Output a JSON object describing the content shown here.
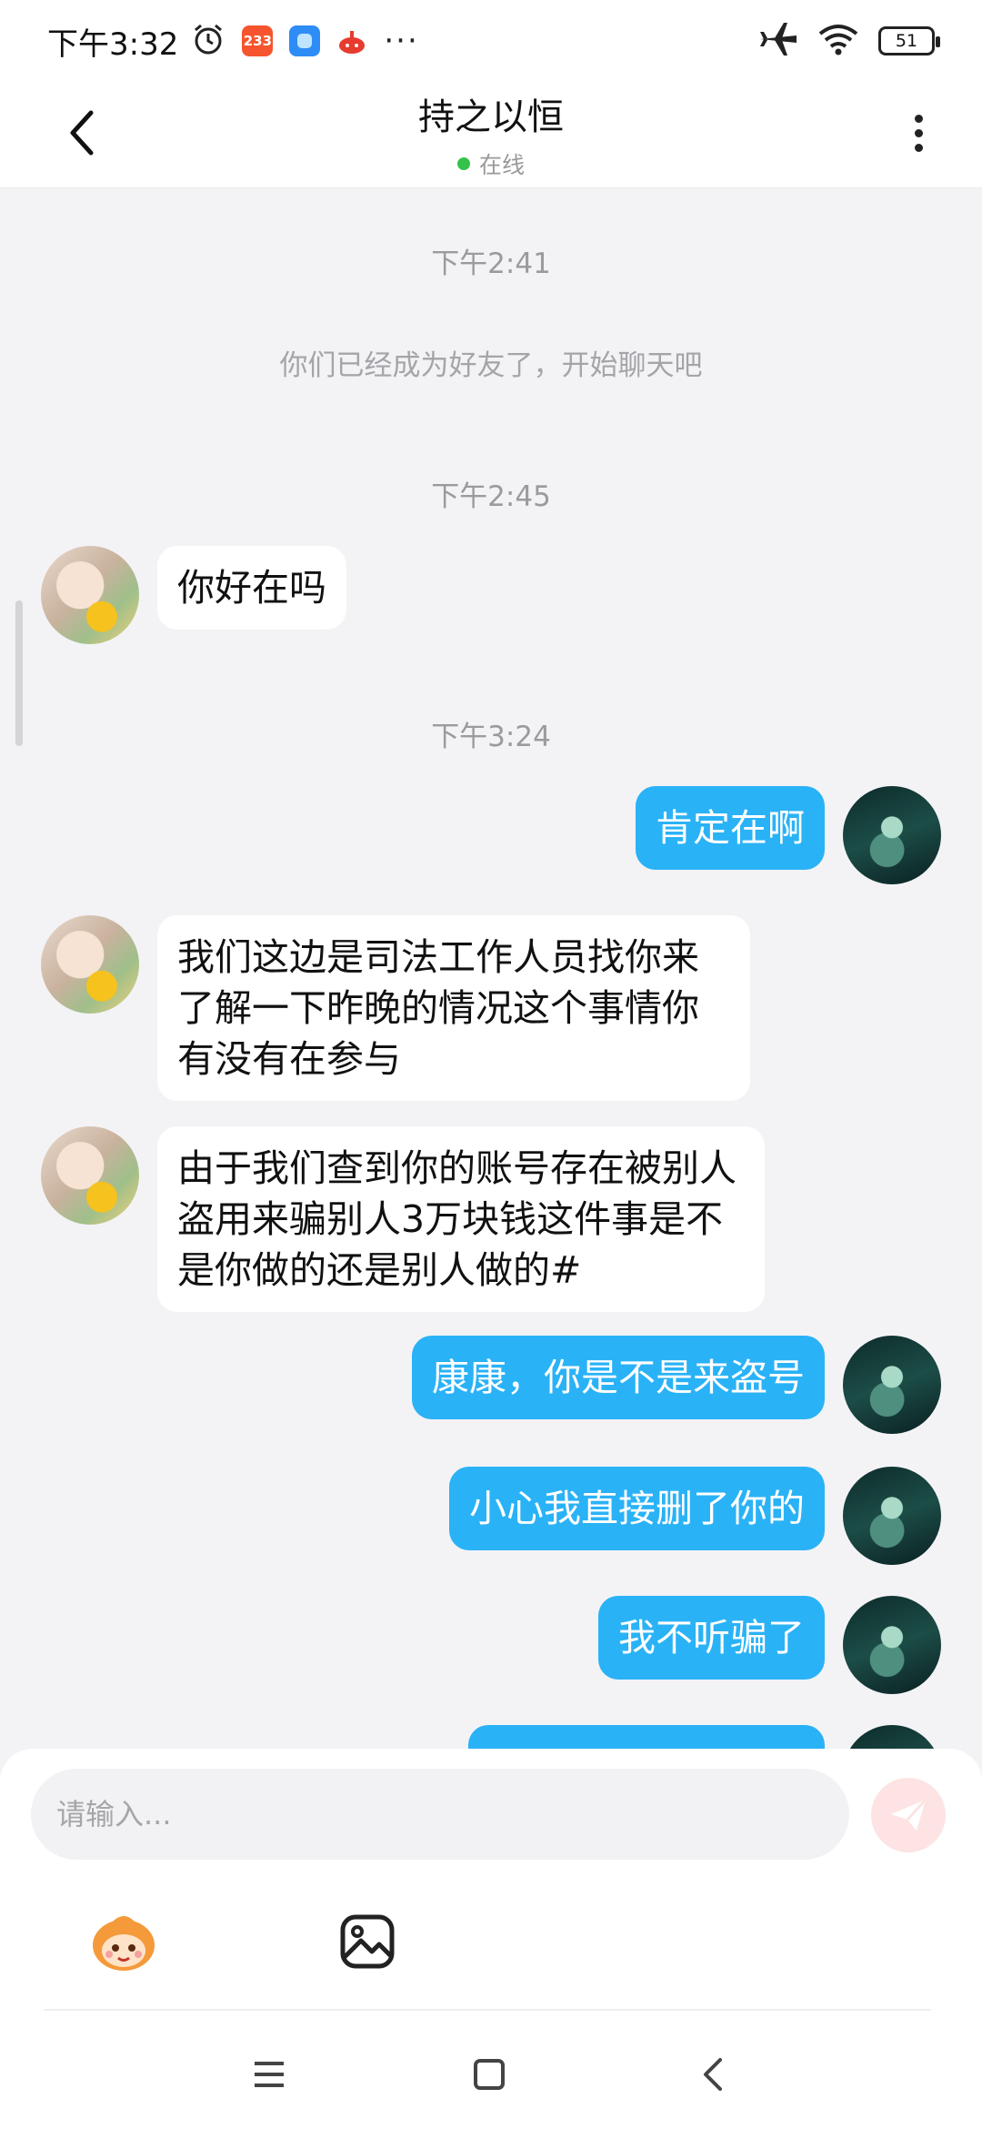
{
  "status_bar": {
    "time": "下午3:32",
    "app_badge_233": "233",
    "battery": "51",
    "more": "···",
    "icons": [
      "alarm-icon",
      "app-233-icon",
      "app-blue-icon",
      "app-red-icon",
      "airplane-icon",
      "wifi-icon",
      "battery-icon"
    ]
  },
  "header": {
    "title": "持之以恒",
    "status": "在线",
    "status_color": "#34c24a"
  },
  "chat": {
    "friend_added_time": "下午2:41",
    "system_notice": "你们已经成为好友了，开始聊天吧",
    "groups": [
      {
        "time": "下午2:45"
      },
      {
        "time": "下午3:24"
      }
    ],
    "messages": [
      {
        "side": "left",
        "text": "你好在吗"
      },
      {
        "side": "right",
        "text": "肯定在啊"
      },
      {
        "side": "left",
        "text": "我们这边是司法工作人员找你来了解一下昨晚的情况这个事情你有没有在参与"
      },
      {
        "side": "left",
        "text": "由于我们查到你的账号存在被别人盗用来骗别人3万块钱这件事是不是你做的还是别人做的#"
      },
      {
        "side": "right",
        "text": "康康，你是不是来盗号"
      },
      {
        "side": "right",
        "text": "小心我直接删了你的"
      },
      {
        "side": "right",
        "text": "我不听骗了"
      }
    ]
  },
  "composer": {
    "placeholder": "请输入..."
  },
  "colors": {
    "accent_bubble": "#2ab2f6",
    "background": "#f3f3f6",
    "send_disabled": "#fde3e3"
  }
}
